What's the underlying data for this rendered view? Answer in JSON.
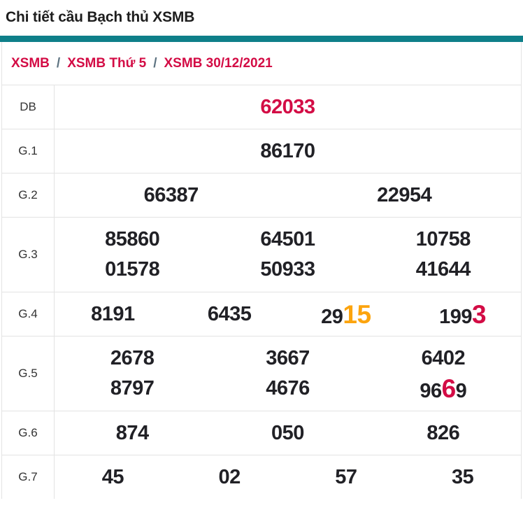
{
  "page": {
    "title": "Chi tiết cầu Bạch thủ XSMB"
  },
  "breadcrumb": {
    "separator": "/",
    "items": [
      "XSMB",
      "XSMB Thứ 5",
      "XSMB 30/12/2021"
    ]
  },
  "colors": {
    "accent_teal": "#0e7f89",
    "crimson": "#d30c45",
    "orange": "#fca40e",
    "border_gray": "#e3e3e3",
    "number_black": "#212126"
  },
  "table": {
    "rows": [
      {
        "label": "DB",
        "lines": [
          [
            {
              "parts": [
                {
                  "text": "62033",
                  "style": "crimson"
                }
              ]
            }
          ]
        ]
      },
      {
        "label": "G.1",
        "lines": [
          [
            {
              "parts": [
                {
                  "text": "86170"
                }
              ]
            }
          ]
        ]
      },
      {
        "label": "G.2",
        "lines": [
          [
            {
              "parts": [
                {
                  "text": "66387"
                }
              ]
            },
            {
              "parts": [
                {
                  "text": "22954"
                }
              ]
            }
          ]
        ]
      },
      {
        "label": "G.3",
        "lines": [
          [
            {
              "parts": [
                {
                  "text": "85860"
                }
              ]
            },
            {
              "parts": [
                {
                  "text": "64501"
                }
              ]
            },
            {
              "parts": [
                {
                  "text": "10758"
                }
              ]
            }
          ],
          [
            {
              "parts": [
                {
                  "text": "01578"
                }
              ]
            },
            {
              "parts": [
                {
                  "text": "50933"
                }
              ]
            },
            {
              "parts": [
                {
                  "text": "41644"
                }
              ]
            }
          ]
        ]
      },
      {
        "label": "G.4",
        "lines": [
          [
            {
              "parts": [
                {
                  "text": "8191"
                }
              ]
            },
            {
              "parts": [
                {
                  "text": "6435"
                }
              ]
            },
            {
              "parts": [
                {
                  "text": "29"
                },
                {
                  "text": "15",
                  "style": "orange-big"
                }
              ]
            },
            {
              "parts": [
                {
                  "text": "199"
                },
                {
                  "text": "3",
                  "style": "crimson-big"
                }
              ]
            }
          ]
        ]
      },
      {
        "label": "G.5",
        "lines": [
          [
            {
              "parts": [
                {
                  "text": "2678"
                }
              ]
            },
            {
              "parts": [
                {
                  "text": "3667"
                }
              ]
            },
            {
              "parts": [
                {
                  "text": "6402"
                }
              ]
            }
          ],
          [
            {
              "parts": [
                {
                  "text": "8797"
                }
              ]
            },
            {
              "parts": [
                {
                  "text": "4676"
                }
              ]
            },
            {
              "parts": [
                {
                  "text": "96"
                },
                {
                  "text": "6",
                  "style": "crimson-big"
                },
                {
                  "text": "9"
                }
              ]
            }
          ]
        ]
      },
      {
        "label": "G.6",
        "lines": [
          [
            {
              "parts": [
                {
                  "text": "874"
                }
              ]
            },
            {
              "parts": [
                {
                  "text": "050"
                }
              ]
            },
            {
              "parts": [
                {
                  "text": "826"
                }
              ]
            }
          ]
        ]
      },
      {
        "label": "G.7",
        "lines": [
          [
            {
              "parts": [
                {
                  "text": "45"
                }
              ]
            },
            {
              "parts": [
                {
                  "text": "02"
                }
              ]
            },
            {
              "parts": [
                {
                  "text": "57"
                }
              ]
            },
            {
              "parts": [
                {
                  "text": "35"
                }
              ]
            }
          ]
        ]
      }
    ]
  }
}
